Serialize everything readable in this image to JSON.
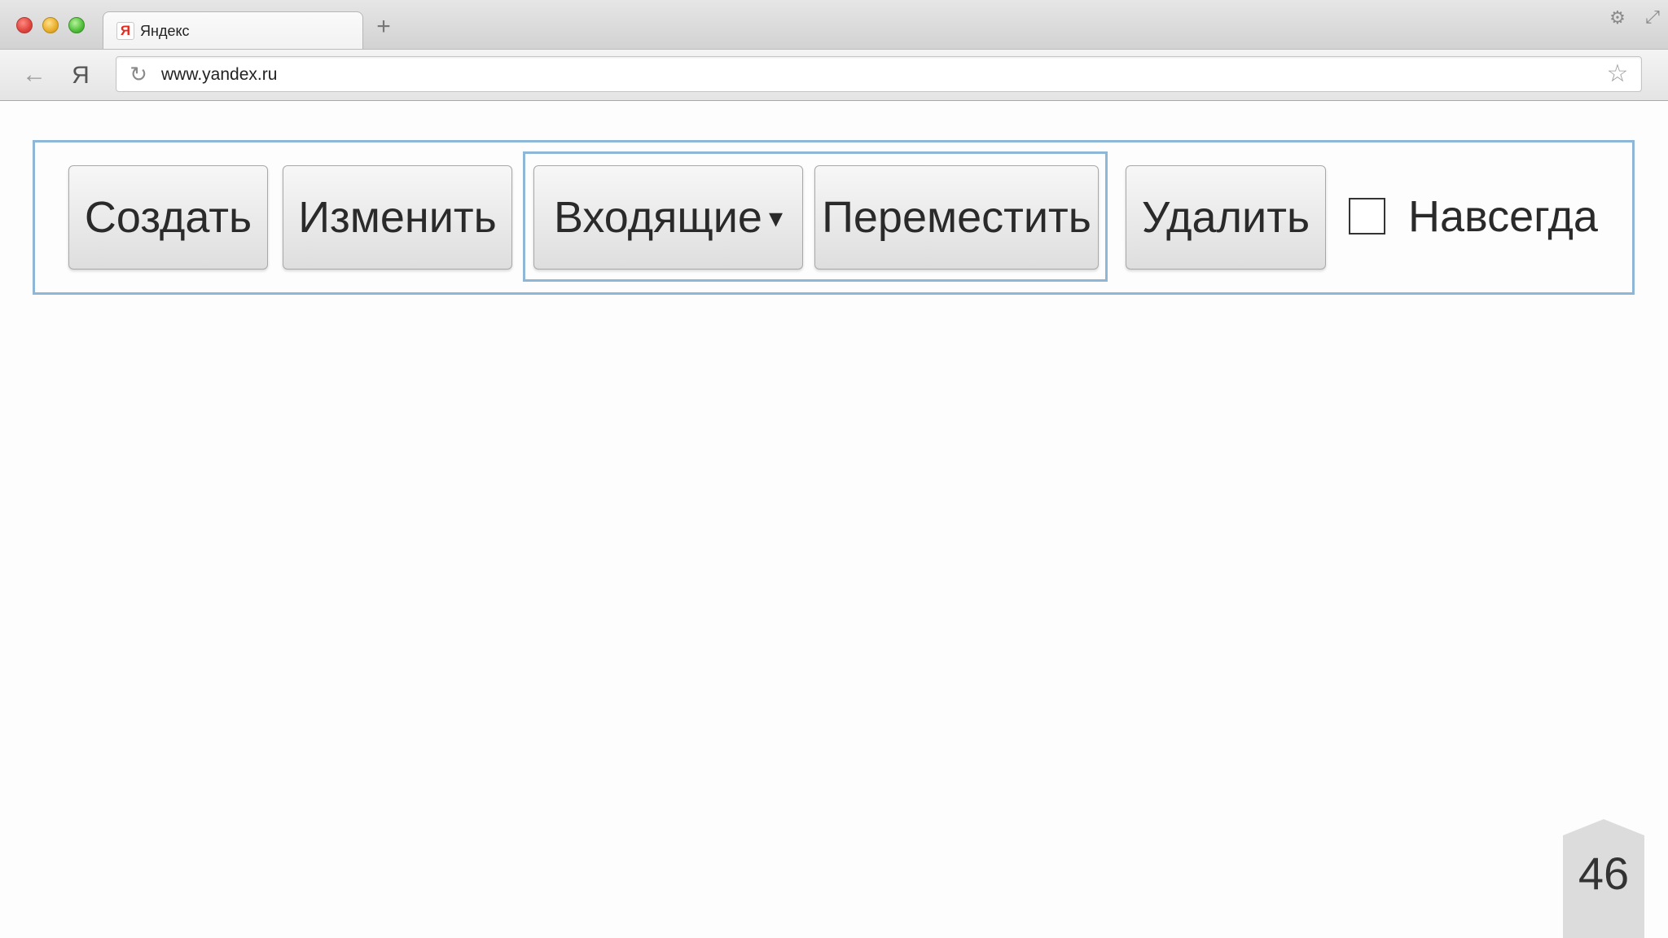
{
  "browser": {
    "tab": {
      "favicon": "Я",
      "title": "Яндекс"
    },
    "new_tab_label": "+",
    "address": {
      "url": "www.yandex.ru"
    },
    "home_label": "Я",
    "icons": {
      "back": "arrow-left-icon",
      "reload": "reload-icon",
      "bookmark": "star-icon",
      "settings": "gear-icon",
      "fullscreen": "resize-icon"
    }
  },
  "page": {
    "buttons": {
      "create": "Создать",
      "edit": "Изменить",
      "inbox": "Входящие",
      "move": "Переместить",
      "delete": "Удалить"
    },
    "inbox_caret": "▾",
    "forever_checkbox": {
      "label": "Навсегда",
      "checked": false
    }
  },
  "slide": {
    "number": "46"
  },
  "colors": {
    "frame_border": "#8eb6d6",
    "button_text": "#2a2a2a"
  }
}
